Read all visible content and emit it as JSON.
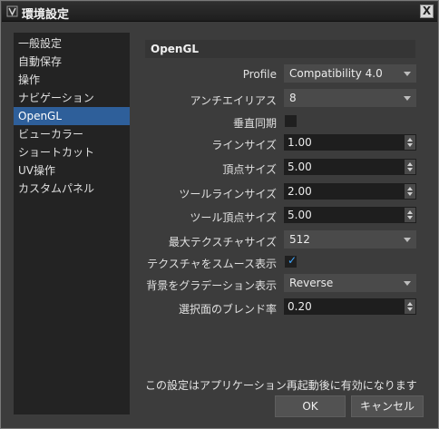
{
  "window": {
    "title": "環境設定",
    "close_glyph": "X"
  },
  "sidebar": {
    "items": [
      {
        "label": "一般設定",
        "selected": false
      },
      {
        "label": "自動保存",
        "selected": false
      },
      {
        "label": "操作",
        "selected": false
      },
      {
        "label": "ナビゲーション",
        "selected": false
      },
      {
        "label": "OpenGL",
        "selected": true
      },
      {
        "label": "ビューカラー",
        "selected": false
      },
      {
        "label": "ショートカット",
        "selected": false
      },
      {
        "label": "UV操作",
        "selected": false
      },
      {
        "label": "カスタムパネル",
        "selected": false
      }
    ]
  },
  "section": {
    "title": "OpenGL"
  },
  "settings": {
    "profile": {
      "label": "Profile",
      "value": "Compatibility 4.0"
    },
    "antialias": {
      "label": "アンチエイリアス",
      "value": "8"
    },
    "vsync": {
      "label": "垂直同期",
      "checked": false
    },
    "line_size": {
      "label": "ラインサイズ",
      "value": "1.00"
    },
    "vertex_size": {
      "label": "頂点サイズ",
      "value": "5.00"
    },
    "tool_line_size": {
      "label": "ツールラインサイズ",
      "value": "2.00"
    },
    "tool_vertex_size": {
      "label": "ツール頂点サイズ",
      "value": "5.00"
    },
    "max_texture_size": {
      "label": "最大テクスチャサイズ",
      "value": "512"
    },
    "smooth_texture": {
      "label": "テクスチャをスムース表示",
      "checked": true,
      "check_glyph": "✓"
    },
    "bg_gradient": {
      "label": "背景をグラデーション表示",
      "value": "Reverse"
    },
    "blend_rate": {
      "label": "選択面のブレンド率",
      "value": "0.20"
    }
  },
  "note": "この設定はアプリケーション再起動後に有効になります",
  "buttons": {
    "ok": "OK",
    "cancel": "キャンセル"
  },
  "colors": {
    "accent": "#2e5f9a",
    "check": "#3fa7ff"
  }
}
